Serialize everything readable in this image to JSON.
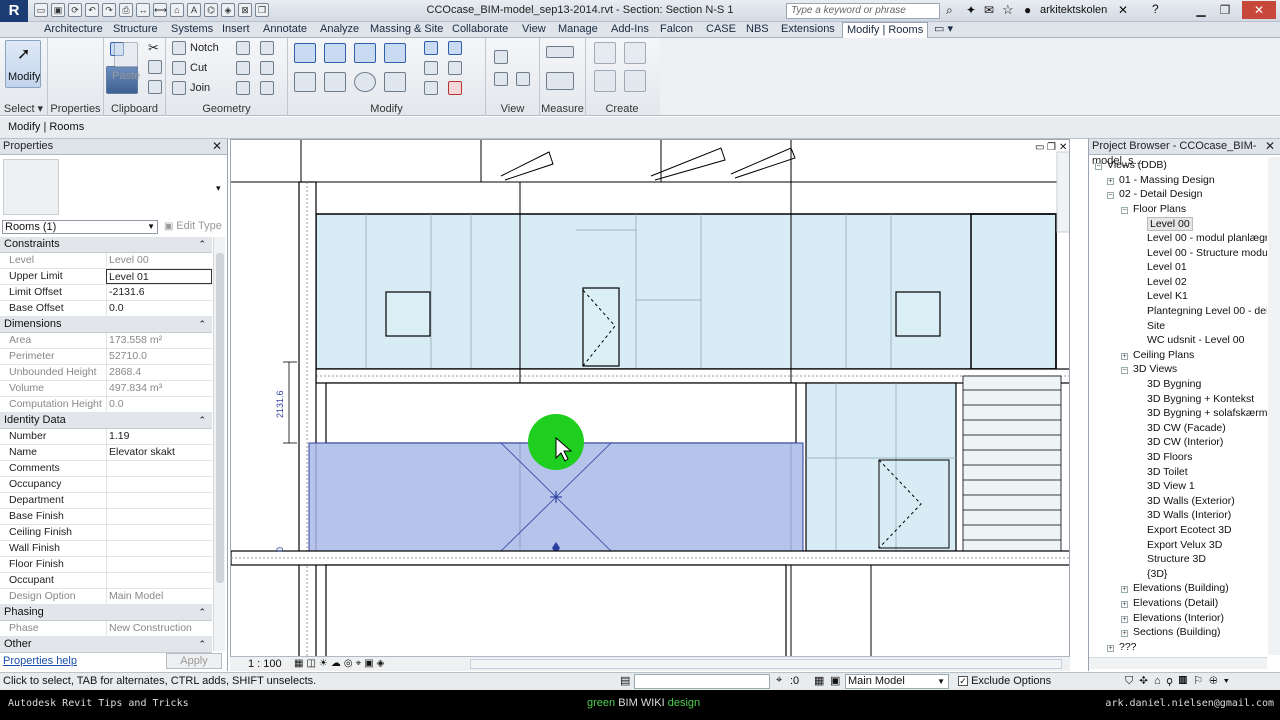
{
  "app": {
    "logo": "R",
    "document_title": "CCOcase_BIM-model_sep13-2014.rvt - Section: Section N-S 1",
    "search_placeholder": "Type a keyword or phrase",
    "user": "arkitektskolen",
    "quick_access_icons": [
      "open-icon",
      "save-icon",
      "sync-icon",
      "undo-icon",
      "redo-icon",
      "print-icon",
      "measure-icon",
      "dimension-icon",
      "tag-icon",
      "text-icon",
      "3d-view-icon",
      "section-icon",
      "close-hidden-icon",
      "switch-windows-icon"
    ]
  },
  "menu": {
    "tabs": [
      "Architecture",
      "Structure",
      "Systems",
      "Insert",
      "Annotate",
      "Analyze",
      "Massing & Site",
      "Collaborate",
      "View",
      "Manage",
      "Add-Ins",
      "Falcon",
      "CASE",
      "NBS",
      "Extensions",
      "Modify | Rooms"
    ],
    "active": "Modify | Rooms"
  },
  "ribbon": {
    "panels": {
      "select": "Select",
      "properties": "Properties",
      "clipboard": "Clipboard",
      "geometry": "Geometry",
      "modify": "Modify",
      "view": "View",
      "measure": "Measure",
      "create": "Create"
    },
    "buttons": {
      "modify": "Modify",
      "paste": "Paste",
      "notch": "Notch",
      "cut": "Cut",
      "join": "Join"
    }
  },
  "context": {
    "label": "Modify | Rooms"
  },
  "properties": {
    "title": "Properties",
    "type_selector": "Rooms (1)",
    "edit_type": "Edit Type",
    "help": "Properties help",
    "apply": "Apply",
    "sections": [
      {
        "name": "Constraints",
        "rows": [
          {
            "k": "Level",
            "v": "Level 00",
            "dis": true
          },
          {
            "k": "Upper Limit",
            "v": "Level 01",
            "box": true
          },
          {
            "k": "Limit Offset",
            "v": "-2131.6"
          },
          {
            "k": "Base Offset",
            "v": "0.0"
          }
        ]
      },
      {
        "name": "Dimensions",
        "rows": [
          {
            "k": "Area",
            "v": "173.558 m²",
            "dis": true
          },
          {
            "k": "Perimeter",
            "v": "52710.0",
            "dis": true
          },
          {
            "k": "Unbounded Height",
            "v": "2868.4",
            "dis": true
          },
          {
            "k": "Volume",
            "v": "497.834 m³",
            "dis": true
          },
          {
            "k": "Computation Height",
            "v": "0.0",
            "dis": true
          }
        ]
      },
      {
        "name": "Identity Data",
        "rows": [
          {
            "k": "Number",
            "v": "1.19"
          },
          {
            "k": "Name",
            "v": "Elevator skakt"
          },
          {
            "k": "Comments",
            "v": ""
          },
          {
            "k": "Occupancy",
            "v": ""
          },
          {
            "k": "Department",
            "v": ""
          },
          {
            "k": "Base Finish",
            "v": ""
          },
          {
            "k": "Ceiling Finish",
            "v": ""
          },
          {
            "k": "Wall Finish",
            "v": ""
          },
          {
            "k": "Floor Finish",
            "v": ""
          },
          {
            "k": "Occupant",
            "v": ""
          },
          {
            "k": "Design Option",
            "v": "Main Model",
            "dis": true
          }
        ]
      },
      {
        "name": "Phasing",
        "rows": [
          {
            "k": "Phase",
            "v": "New Construction",
            "dis": true
          }
        ]
      },
      {
        "name": "Other",
        "rows": []
      }
    ]
  },
  "view": {
    "scale": "1 : 100",
    "dimension_label": "2131.6",
    "dimension_label_small": "0"
  },
  "browser": {
    "title": "Project Browser - CCOcase_BIM-model_s...",
    "nodes": [
      {
        "t": "Views (DDB)",
        "lvl": 0,
        "pm": "-"
      },
      {
        "t": "01 - Massing Design",
        "lvl": 1,
        "pm": "+"
      },
      {
        "t": "02 - Detail Design",
        "lvl": 1,
        "pm": "-"
      },
      {
        "t": "Floor Plans",
        "lvl": 2,
        "pm": "-"
      },
      {
        "t": "Level 00",
        "lvl": 3,
        "sel": true
      },
      {
        "t": "Level 00 - modul planlægn",
        "lvl": 3
      },
      {
        "t": "Level 00 - Structure modu",
        "lvl": 3
      },
      {
        "t": "Level 01",
        "lvl": 3
      },
      {
        "t": "Level 02",
        "lvl": 3
      },
      {
        "t": "Level K1",
        "lvl": 3
      },
      {
        "t": "Plantegning Level 00 - del",
        "lvl": 3
      },
      {
        "t": "Site",
        "lvl": 3
      },
      {
        "t": "WC udsnit - Level 00",
        "lvl": 3
      },
      {
        "t": "Ceiling Plans",
        "lvl": 2,
        "pm": "+"
      },
      {
        "t": "3D Views",
        "lvl": 2,
        "pm": "-"
      },
      {
        "t": "3D Bygning",
        "lvl": 3
      },
      {
        "t": "3D Bygning + Kontekst",
        "lvl": 3
      },
      {
        "t": "3D Bygning + solafskærmi",
        "lvl": 3
      },
      {
        "t": "3D CW (Facade)",
        "lvl": 3
      },
      {
        "t": "3D CW (Interior)",
        "lvl": 3
      },
      {
        "t": "3D Floors",
        "lvl": 3
      },
      {
        "t": "3D Toilet",
        "lvl": 3
      },
      {
        "t": "3D View 1",
        "lvl": 3
      },
      {
        "t": "3D Walls (Exterior)",
        "lvl": 3
      },
      {
        "t": "3D Walls (Interior)",
        "lvl": 3
      },
      {
        "t": "Export Ecotect 3D",
        "lvl": 3
      },
      {
        "t": "Export Velux 3D",
        "lvl": 3
      },
      {
        "t": "Structure 3D",
        "lvl": 3
      },
      {
        "t": "{3D}",
        "lvl": 3
      },
      {
        "t": "Elevations (Building)",
        "lvl": 2,
        "pm": "+"
      },
      {
        "t": "Elevations (Detail)",
        "lvl": 2,
        "pm": "+"
      },
      {
        "t": "Elevations (Interior)",
        "lvl": 2,
        "pm": "+"
      },
      {
        "t": "Sections (Building)",
        "lvl": 2,
        "pm": "+"
      },
      {
        "t": "???",
        "lvl": 1,
        "pm": "+"
      }
    ]
  },
  "status": {
    "message": "Click to select, TAB for alternates, CTRL adds, SHIFT unselects.",
    "counter": ":0",
    "model": "Main Model",
    "exclude": "Exclude Options"
  },
  "footer": {
    "left": "Autodesk Revit Tips and Tricks",
    "center_a": "green",
    "center_b": "BIM WIKI",
    "center_c": "design",
    "right": "ark.daniel.nielsen@gmail.com"
  },
  "colors": {
    "room_fill": "#a9b8e6",
    "curtain_fill": "#d7ecf5",
    "cursor_highlight": "#1fcf1f"
  }
}
